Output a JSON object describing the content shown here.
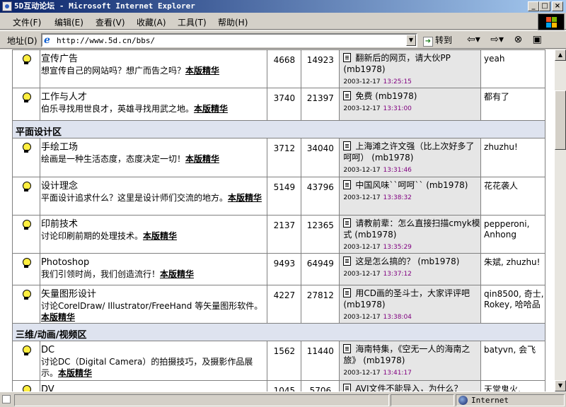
{
  "window": {
    "title": "5D互动论坛 - Microsoft Internet Explorer",
    "min": "_",
    "max": "□",
    "close": "×"
  },
  "menu": [
    "文件(F)",
    "编辑(E)",
    "查看(V)",
    "收藏(A)",
    "工具(T)",
    "帮助(H)"
  ],
  "address": {
    "label": "地址(D)",
    "url": "http://www.5d.cn/bbs/",
    "go": "转到"
  },
  "status": {
    "zone": "Internet"
  },
  "rows": [
    {
      "name": "宣传广告",
      "desc": "想宣传自己的网站吗？想广而告之吗？",
      "link": "本版精华",
      "topics": "4668",
      "posts": "14923",
      "last_title": "翻新后的网页，请大伙PP",
      "last_by": "(mb1978)",
      "date": "2003-12-17",
      "time": "13:25:15",
      "mods": "yeah",
      "h": 54
    },
    {
      "name": "工作与人才",
      "desc": "伯乐寻找用世良才，英雄寻找用武之地。",
      "link": "本版精华",
      "topics": "3740",
      "posts": "21397",
      "last_title": "免费",
      "last_by": "(mb1978)",
      "date": "2003-12-17",
      "time": "13:31:00",
      "mods": "都有了",
      "h": 46
    },
    {
      "section": "平面设计区"
    },
    {
      "name": "手绘工场",
      "desc": "绘画是一种生活态度，态度决定一切！",
      "link": "本版精华",
      "topics": "3712",
      "posts": "34040",
      "last_title": "上海滩之许文强（比上次好多了呵呵）",
      "last_by": "(mb1978)",
      "date": "2003-12-17",
      "time": "13:31:46",
      "mods": "zhuzhu!",
      "h": 55
    },
    {
      "name": "设计理念",
      "desc": "平面设计追求什么？这里是设计师们交流的地方。",
      "link": "本版精华",
      "topics": "5149",
      "posts": "43796",
      "last_title": "中国风味``呵呵``",
      "last_by": "(mb1978)",
      "date": "2003-12-17",
      "time": "13:38:32",
      "mods": "花花袭人",
      "h": 54
    },
    {
      "name": "印前技术",
      "desc": "讨论印刷前期的处理技术。",
      "link": "本版精华",
      "topics": "2137",
      "posts": "12365",
      "last_title": "请教前辈：怎么直接扫描cmyk模式",
      "last_by": "(mb1978)",
      "date": "2003-12-17",
      "time": "13:35:29",
      "mods": "pepperoni, Anhong",
      "h": 54
    },
    {
      "name": "Photoshop",
      "desc": "我们引领时尚，我们创造流行！",
      "link": "本版精华",
      "topics": "9493",
      "posts": "64949",
      "last_title": "这是怎么搞的？",
      "last_by": "(mb1978)",
      "date": "2003-12-17",
      "time": "13:37:12",
      "mods": "朱斌, zhuzhu!",
      "h": 45
    },
    {
      "name": "矢量图形设计",
      "desc": "讨论CorelDraw/ Illustrator/FreeHand 等矢量图形软件。",
      "link": "本版精华",
      "topics": "4227",
      "posts": "27812",
      "last_title": "用CD画的圣斗士，大家评评吧",
      "last_by": "(mb1978)",
      "date": "2003-12-17",
      "time": "13:38:04",
      "mods": "qin8500, 奇士, Rokey, 哈哈品",
      "h": 53
    },
    {
      "section": "三维/动画/视频区"
    },
    {
      "name": "DC",
      "desc": "讨论DC（Digital Camera）的拍摄技巧，及摄影作品展示。",
      "link": "本版精华",
      "topics": "1562",
      "posts": "11440",
      "last_title": "海南特集，《空无一人的海南之旅》",
      "last_by": "(mb1978)",
      "date": "2003-12-17",
      "time": "13:41:17",
      "mods": "batyvn, 会飞",
      "h": 56
    },
    {
      "name": "DV",
      "desc": "",
      "link": "",
      "topics": "1045",
      "posts": "5706",
      "last_title": "AVI文件不能导入，为什么？",
      "last_by": "",
      "date": "",
      "time": "",
      "mods": "天堂鬼火,",
      "h": 40
    }
  ]
}
